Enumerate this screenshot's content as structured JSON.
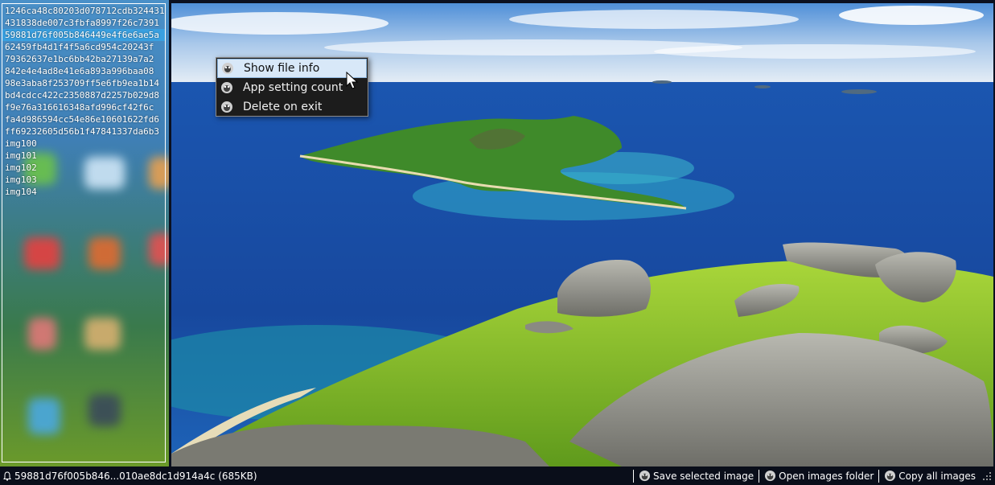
{
  "list": {
    "items": [
      "1246ca48c80203d078712cdb324431",
      "431838de007c3fbfa8997f26c7391",
      "59881d76f005b846449e4f6e6ae5a",
      "62459fb4d1f4f5a6cd954c20243f",
      "79362637e1bc6bb42ba27139a7a2",
      "842e4e4ad8e41e6a893a996baa08",
      "98e3aba8f253709ff5e6fb9ea1b14",
      "bd4cdcc422c2350887d2257b029d8",
      "f9e76a316616348afd996cf42f6c",
      "fa4d986594cc54e86e10601622fd6",
      "ff69232605d56b1f47841337da6b3",
      "img100",
      "img101",
      "img102",
      "img103",
      "img104"
    ],
    "selected_index": 2
  },
  "context_menu": {
    "items": [
      {
        "label": "Show file info",
        "icon": "app-logo-icon"
      },
      {
        "label": "App setting count",
        "icon": "app-logo-icon"
      },
      {
        "label": "Delete on exit",
        "icon": "app-logo-icon"
      }
    ]
  },
  "status_bar": {
    "file_label": "59881d76f005b846...010ae8dc1d914a4c (685KB)",
    "save_label": "Save selected image",
    "open_label": "Open images folder",
    "copy_label": "Copy all images"
  }
}
